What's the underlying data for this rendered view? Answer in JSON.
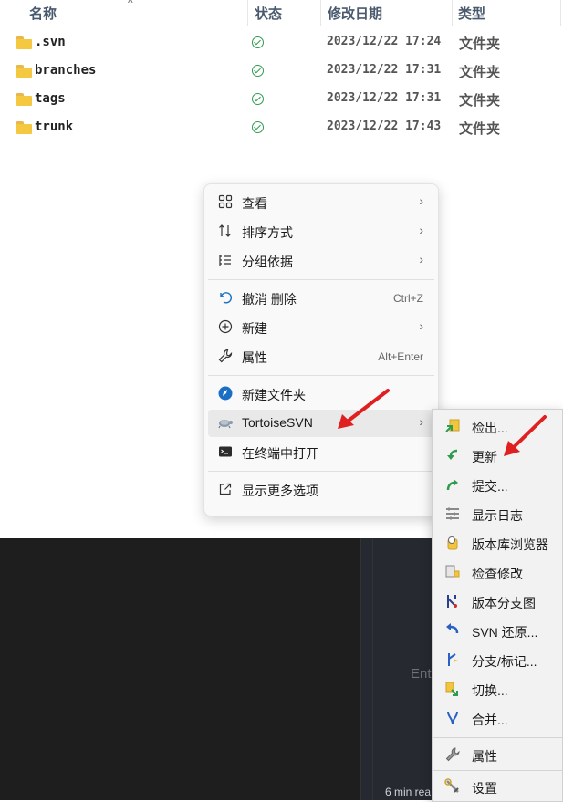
{
  "explorer": {
    "columns": {
      "name": "名称",
      "status": "状态",
      "date": "修改日期",
      "type": "类型"
    },
    "sort_indicator": "^",
    "rows": [
      {
        "name": ".svn",
        "date": "2023/12/22 17:24",
        "type": "文件夹"
      },
      {
        "name": "branches",
        "date": "2023/12/22 17:31",
        "type": "文件夹"
      },
      {
        "name": "tags",
        "date": "2023/12/22 17:31",
        "type": "文件夹"
      },
      {
        "name": "trunk",
        "date": "2023/12/22 17:43",
        "type": "文件夹"
      }
    ]
  },
  "context_menu": {
    "items": [
      {
        "label": "查看",
        "icon": "grid-icon"
      },
      {
        "label": "排序方式",
        "icon": "sort-icon"
      },
      {
        "label": "分组依据",
        "icon": "group-list-icon"
      },
      {
        "label": "撤消 删除",
        "shortcut": "Ctrl+Z",
        "icon": "undo-icon"
      },
      {
        "label": "新建",
        "icon": "plus-circle-icon"
      },
      {
        "label": "属性",
        "shortcut": "Alt+Enter",
        "icon": "wrench-icon"
      },
      {
        "label": "新建文件夹",
        "icon": "new-folder-icon"
      },
      {
        "label": "TortoiseSVN",
        "icon": "tortoise-icon"
      },
      {
        "label": "在终端中打开",
        "icon": "terminal-icon"
      },
      {
        "label": "显示更多选项",
        "icon": "external-icon"
      }
    ]
  },
  "svn_submenu": {
    "items": [
      {
        "label": "检出...",
        "icon": "checkout-icon"
      },
      {
        "label": "更新",
        "icon": "update-icon"
      },
      {
        "label": "提交...",
        "icon": "commit-icon"
      },
      {
        "label": "显示日志",
        "icon": "log-icon"
      },
      {
        "label": "版本库浏览器",
        "icon": "repo-browser-icon"
      },
      {
        "label": "检查修改",
        "icon": "check-modifications-icon"
      },
      {
        "label": "版本分支图",
        "icon": "revision-graph-icon"
      },
      {
        "label": "SVN 还原...",
        "icon": "revert-icon"
      },
      {
        "label": "分支/标记...",
        "icon": "branch-tag-icon"
      },
      {
        "label": "切换...",
        "icon": "switch-icon"
      },
      {
        "label": "合并...",
        "icon": "merge-icon"
      },
      {
        "label": "属性",
        "icon": "properties-icon"
      },
      {
        "label": "设置",
        "icon": "settings-icon"
      }
    ]
  },
  "background": {
    "ghost_text": "Ent",
    "read_time": "6 min rea"
  },
  "colors": {
    "status_ok": "#2e9c4e",
    "annotation_arrow": "#e02020",
    "folder": "#f5c842"
  }
}
